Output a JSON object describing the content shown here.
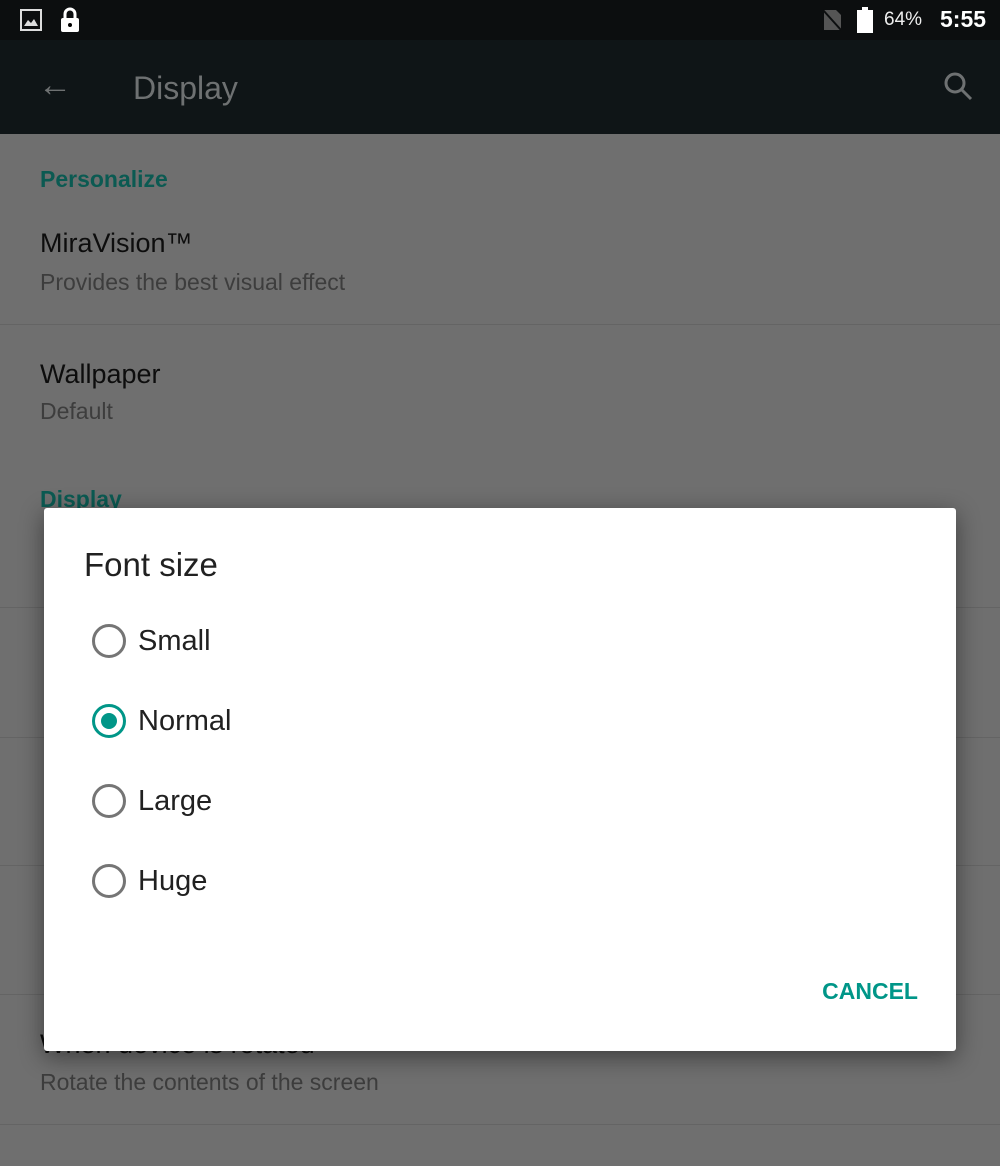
{
  "status_bar": {
    "battery": "64%",
    "time": "5:55",
    "icons": [
      "image-icon",
      "lock-icon",
      "no-sim-icon",
      "battery-icon"
    ]
  },
  "app_bar": {
    "title": "Display",
    "icons": [
      "back-arrow-icon",
      "search-icon"
    ]
  },
  "settings": {
    "sections": [
      {
        "header": "Personalize"
      },
      {
        "header": "Display"
      }
    ],
    "items": [
      {
        "title": "MiraVision™",
        "summary": "Provides the best visual effect"
      },
      {
        "title": "Wallpaper",
        "summary": "Default"
      },
      {
        "title": "When device is rotated",
        "summary": "Rotate the contents of the screen"
      }
    ]
  },
  "dialog": {
    "title": "Font size",
    "options": [
      {
        "label": "Small",
        "selected": false
      },
      {
        "label": "Normal",
        "selected": true
      },
      {
        "label": "Large",
        "selected": false
      },
      {
        "label": "Huge",
        "selected": false
      }
    ],
    "cancel_label": "CANCEL"
  },
  "colors": {
    "accent": "#009688",
    "scrim_bg": "#6f6f6f",
    "app_bar": "#0f1517"
  }
}
